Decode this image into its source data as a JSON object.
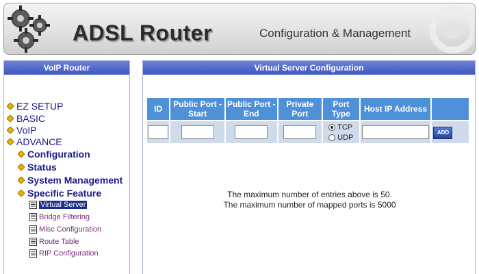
{
  "header": {
    "brand": "ADSL Router",
    "tagline": "Configuration & Management"
  },
  "sidebar": {
    "title": "VoIP Router",
    "items": [
      {
        "label": "EZ SETUP",
        "level": 0,
        "icon": "diamond-bullet-icon"
      },
      {
        "label": "BASIC",
        "level": 0,
        "icon": "diamond-bullet-icon"
      },
      {
        "label": "VoIP",
        "level": 0,
        "icon": "diamond-bullet-icon"
      },
      {
        "label": "ADVANCE",
        "level": 0,
        "icon": "diamond-bullet-icon"
      },
      {
        "label": "Configuration",
        "level": 1,
        "icon": "diamond-bullet-icon"
      },
      {
        "label": "Status",
        "level": 1,
        "icon": "diamond-bullet-icon"
      },
      {
        "label": "System Management",
        "level": 1,
        "icon": "diamond-bullet-icon"
      },
      {
        "label": "Specific Feature",
        "level": 1,
        "icon": "diamond-bullet-icon"
      },
      {
        "label": "Virtual Server",
        "level": 2,
        "icon": "document-icon",
        "selected": true
      },
      {
        "label": "Bridge Filtering",
        "level": 2,
        "icon": "document-icon"
      },
      {
        "label": "Misc Configuration",
        "level": 2,
        "icon": "document-icon"
      },
      {
        "label": "Route Table",
        "level": 2,
        "icon": "document-icon"
      },
      {
        "label": "RIP Configuration",
        "level": 2,
        "icon": "document-icon"
      }
    ]
  },
  "main": {
    "title": "Virtual Server Configuration",
    "columns": [
      "ID",
      "Public Port - Start",
      "Public Port - End",
      "Private Port",
      "Port Type",
      "Host IP Address",
      ""
    ],
    "row": {
      "id": "",
      "public_port_start": "",
      "public_port_end": "",
      "private_port": "",
      "port_type_options": [
        "TCP",
        "UDP"
      ],
      "port_type_selected": "TCP",
      "host_ip": ""
    },
    "add_label": "ADD",
    "notes": [
      "The maximum number of entries above is 50.",
      "The maximum number of mapped ports is 5000"
    ]
  },
  "colors": {
    "panel_header": "#3d56c4",
    "table_header": "#4f91d8",
    "table_cell": "#cfdbea",
    "nav_text": "#1a1a8c",
    "subnav_text": "#7a2b7a",
    "selected_bg": "#1c2e8c"
  }
}
